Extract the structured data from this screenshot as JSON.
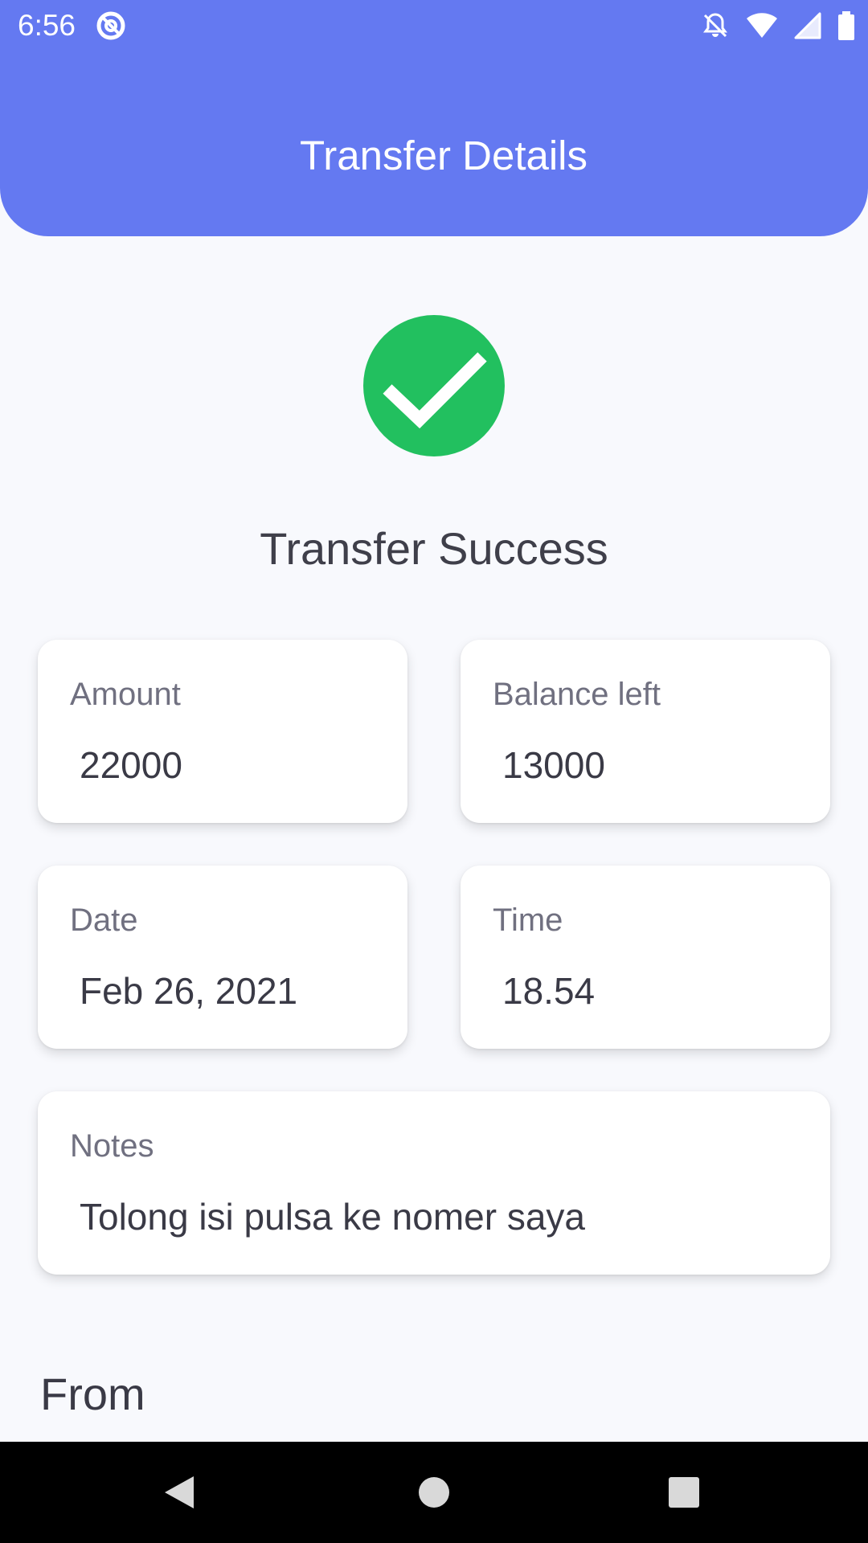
{
  "status_bar": {
    "time": "6:56",
    "icons": [
      "app-notification-icon",
      "bell-off-icon",
      "wifi-icon",
      "signal-icon",
      "battery-icon"
    ]
  },
  "header": {
    "title": "Transfer Details",
    "background_color": "#6479f1"
  },
  "status": {
    "icon": "check-circle-icon",
    "icon_color": "#22c05f",
    "message": "Transfer Success"
  },
  "details": {
    "amount": {
      "label": "Amount",
      "value": "22000"
    },
    "balance": {
      "label": "Balance left",
      "value": "13000"
    },
    "date": {
      "label": "Date",
      "value": "Feb 26, 2021"
    },
    "time": {
      "label": "Time",
      "value": "18.54"
    },
    "notes": {
      "label": "Notes",
      "value": "Tolong isi pulsa ke nomer saya"
    }
  },
  "from_section": {
    "heading": "From"
  },
  "nav_bar": {
    "buttons": [
      "back-icon",
      "home-icon",
      "recents-icon"
    ]
  }
}
